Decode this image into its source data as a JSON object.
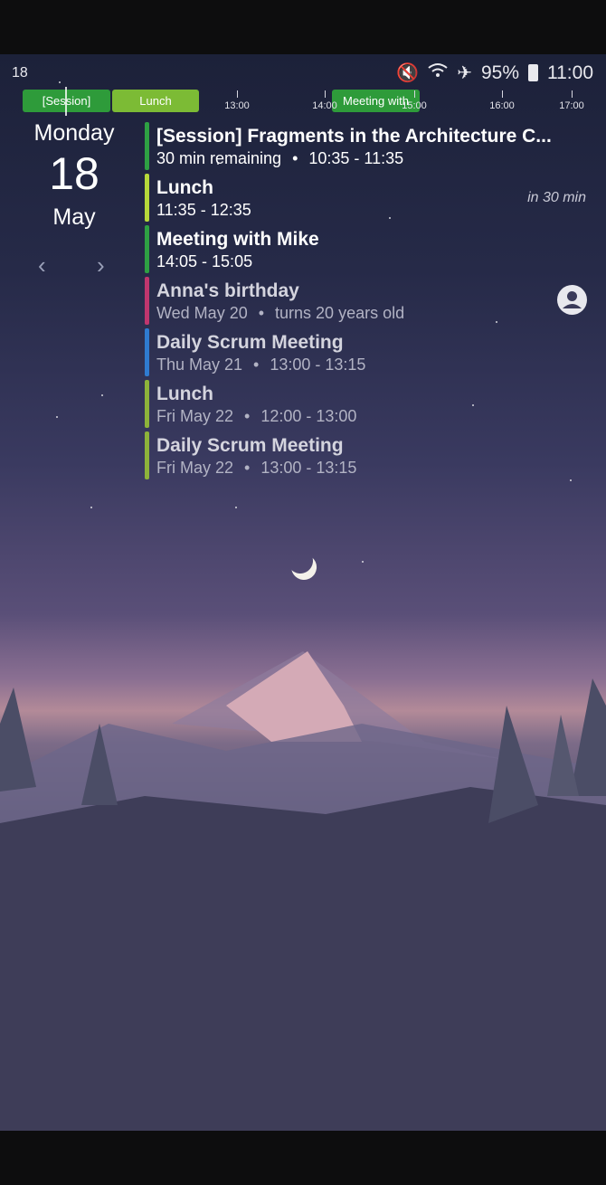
{
  "status_bar": {
    "left_text": "18",
    "battery": "95%",
    "time": "11:00",
    "icons": [
      "mute-icon",
      "wifi-icon",
      "airplane-icon",
      "battery-icon"
    ]
  },
  "timeline": {
    "pills": [
      {
        "label": "[Session]",
        "color": "#2e9b3a"
      },
      {
        "label": "Lunch",
        "color": "#7cbb35"
      },
      {
        "label": "Meeting with",
        "color": "#2e9b3a"
      }
    ],
    "ticks": [
      "13:00",
      "14:00",
      "15:00",
      "16:00",
      "17:00"
    ]
  },
  "date": {
    "day_name": "Monday",
    "day_num": "18",
    "month": "May"
  },
  "events": [
    {
      "title": "[Session] Fragments in the Architecture C...",
      "sub_a": "30 min remaining",
      "sub_b": "10:35 - 11:35",
      "color": "#2ea043"
    },
    {
      "title": "Lunch",
      "sub_a": "11:35 - 12:35",
      "sub_b": "",
      "color": "#b6d83a"
    },
    {
      "title": "Meeting with Mike",
      "sub_a": "14:05 - 15:05",
      "sub_b": "",
      "color": "#2ea043"
    },
    {
      "title": "Anna's birthday",
      "sub_a": "Wed May 20",
      "sub_b": "turns 20 years old",
      "color": "#c0366e"
    },
    {
      "title": "Daily Scrum Meeting",
      "sub_a": "Thu May 21",
      "sub_b": "13:00 - 13:15",
      "color": "#2f7bd0"
    },
    {
      "title": "Lunch",
      "sub_a": "Fri May 22",
      "sub_b": "12:00 - 13:00",
      "color": "#8db33a"
    },
    {
      "title": "Daily Scrum Meeting",
      "sub_a": "Fri May 22",
      "sub_b": "13:00 - 13:15",
      "color": "#8db33a"
    }
  ],
  "in_label": "in 30 min"
}
